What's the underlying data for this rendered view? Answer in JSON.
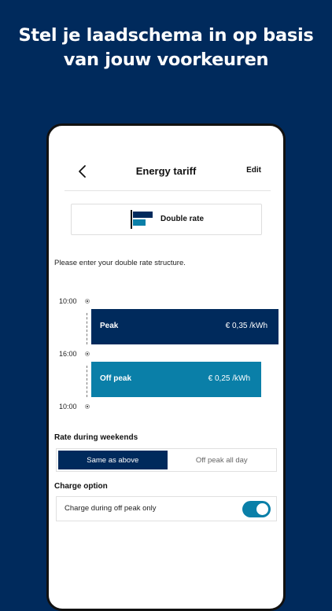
{
  "headline": {
    "line1": "Stel je laadschema in op basis",
    "line2": "van jouw voorkeuren"
  },
  "nav": {
    "back_icon": "chevron-left-icon",
    "title": "Energy tariff",
    "edit_label": "Edit"
  },
  "tariff_type": {
    "icon": "double-rate-icon",
    "label": "Double rate"
  },
  "instruction": "Please enter your double rate structure.",
  "schedule": {
    "times": [
      "10:00",
      "16:00",
      "10:00"
    ],
    "periods": [
      {
        "name": "Peak",
        "price": "€ 0,35 /kWh"
      },
      {
        "name": "Off peak",
        "price": "€ 0,25 /kWh"
      }
    ]
  },
  "weekend": {
    "title": "Rate during weekends",
    "options": [
      "Same as above",
      "Off peak all day"
    ],
    "selected": "Same as above"
  },
  "charge_option": {
    "title": "Charge option",
    "label": "Charge during off peak only",
    "enabled": true
  },
  "colors": {
    "brand_navy": "#002a5c",
    "accent_teal": "#0a7fa8"
  }
}
